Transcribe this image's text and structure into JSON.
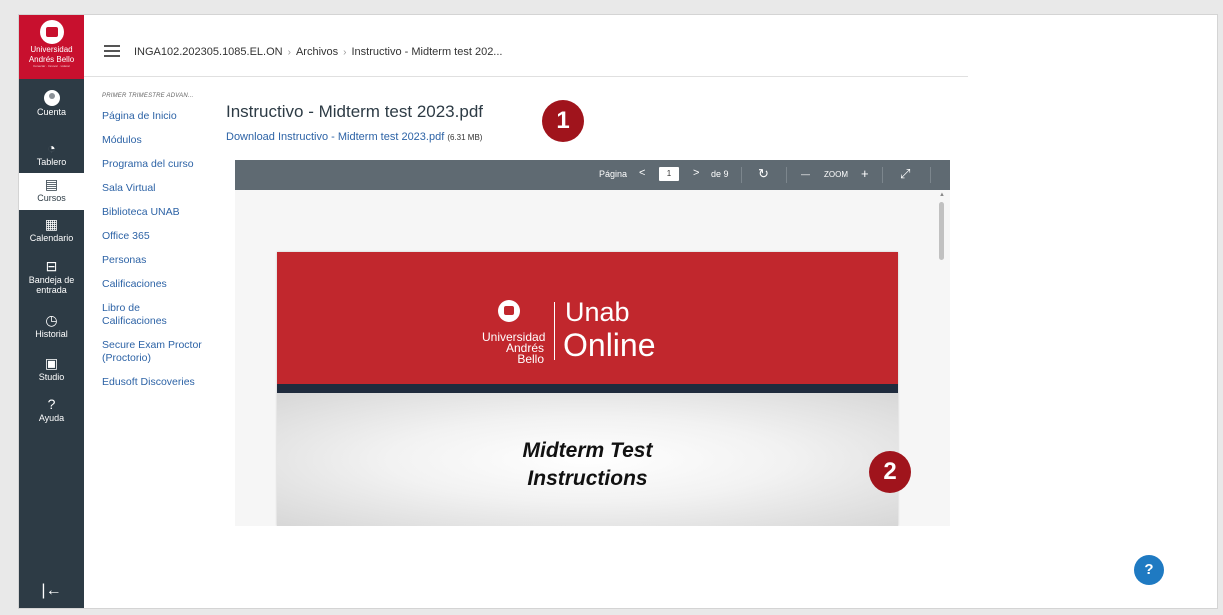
{
  "global_nav": {
    "logo": {
      "line1": "Universidad",
      "line2": "Andrés Bello",
      "tagline": "Conectar · Innovar · Liderar"
    },
    "items": [
      {
        "label": "Cuenta",
        "icon": "avatar-icon"
      },
      {
        "label": "Tablero",
        "icon": "dashboard-icon",
        "glyph": "◔"
      },
      {
        "label": "Cursos",
        "icon": "courses-icon",
        "glyph": "▤"
      },
      {
        "label": "Calendario",
        "icon": "calendar-icon",
        "glyph": "▦"
      },
      {
        "label": "Bandeja de entrada",
        "icon": "inbox-icon",
        "glyph": "⊟"
      },
      {
        "label": "Historial",
        "icon": "history-icon",
        "glyph": "◷"
      },
      {
        "label": "Studio",
        "icon": "studio-icon",
        "glyph": "▣"
      },
      {
        "label": "Ayuda",
        "icon": "help-icon",
        "glyph": "?"
      }
    ],
    "collapse_glyph": "|←"
  },
  "breadcrumb": {
    "items": [
      "INGA102.202305.1085.EL.ON",
      "Archivos",
      "Instructivo - Midterm test 202..."
    ],
    "separator": "›"
  },
  "course_nav": {
    "term": "PRIMER TRIMESTRE ADVAN...",
    "items": [
      "Página de Inicio",
      "Módulos",
      "Programa del curso",
      "Sala Virtual",
      "Biblioteca UNAB",
      "Office 365",
      "Personas",
      "Calificaciones",
      "Libro de Calificaciones",
      "Secure Exam Proctor (Proctorio)",
      "Edusoft Discoveries"
    ]
  },
  "file": {
    "title": "Instructivo - Midterm test 2023.pdf",
    "download_label": "Download Instructivo - Midterm test 2023.pdf",
    "size": "(6.31 MB)"
  },
  "viewer": {
    "page_label": "Página",
    "current_page": "1",
    "total_pages": "de 9",
    "zoom_label": "ZOOM",
    "prev_glyph": "<",
    "next_glyph": ">",
    "rotate_glyph": "↻",
    "zoom_out_glyph": "—",
    "zoom_in_glyph": "+",
    "fullscreen_glyph": "⤢"
  },
  "pdf_page": {
    "brand_uni_line1": "Universidad",
    "brand_uni_line2": "Andrés Bello",
    "brand_unab": "Unab",
    "brand_online": "Online",
    "title_line1": "Midterm Test",
    "title_line2": "Instructions"
  },
  "badges": [
    "1",
    "2"
  ],
  "help_glyph": "?",
  "colors": {
    "nav_bg": "#2d3b45",
    "brand_red": "#c8102e",
    "link": "#2d63a6",
    "badge": "#a0141c",
    "toolbar": "#5f6a72",
    "help": "#1f7ac2"
  }
}
